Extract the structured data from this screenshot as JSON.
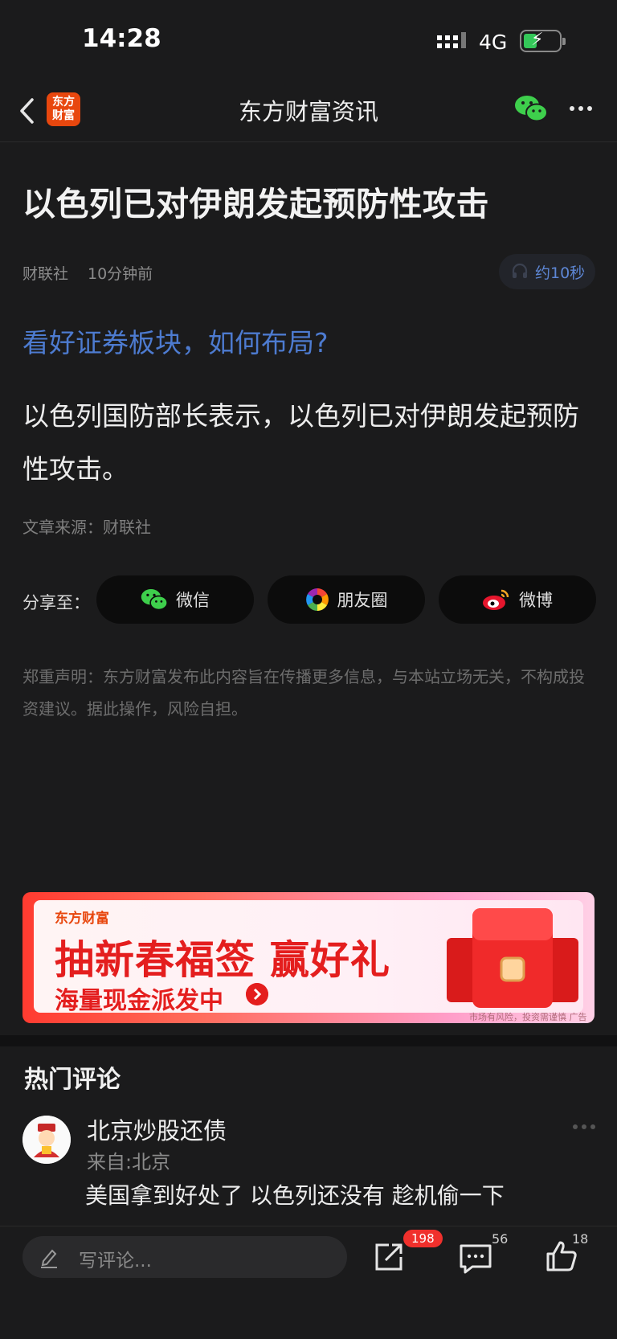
{
  "status_bar": {
    "time": "14:28",
    "network": "4G"
  },
  "nav": {
    "logo_line1": "东方",
    "logo_line2": "财富",
    "title": "东方财富资讯"
  },
  "article": {
    "headline": "以色列已对伊朗发起预防性攻击",
    "source": "财联社",
    "time_ago": "10分钟前",
    "listen_label": "约10秒",
    "promo_link": "看好证券板块，如何布局?",
    "body": "以色列国防部长表示，以色列已对伊朗发起预防性攻击。",
    "source_line": "文章来源：财联社",
    "disclaimer": "郑重声明：东方财富发布此内容旨在传播更多信息，与本站立场无关，不构成投资建议。据此操作，风险自担。"
  },
  "share": {
    "label": "分享至：",
    "buttons": [
      {
        "label": "微信",
        "icon": "wechat-icon"
      },
      {
        "label": "朋友圈",
        "icon": "moments-icon"
      },
      {
        "label": "微博",
        "icon": "weibo-icon"
      }
    ]
  },
  "banner": {
    "brand": "东方财富",
    "title": "抽新春福签 赢好礼",
    "subtitle": "海量现金派发中",
    "risk_note": "市场有风险，投资需谨慎 广告"
  },
  "comments": {
    "section_title": "热门评论",
    "items": [
      {
        "user": "北京炒股还债",
        "location": "来自:北京",
        "text": "美国拿到好处了 以色列还没有 趁机偷一下"
      }
    ]
  },
  "bottom_bar": {
    "input_placeholder": "写评论...",
    "share_count": "198",
    "comment_count": "56",
    "like_count": "18"
  },
  "colors": {
    "accent_blue": "#4d7bd0",
    "badge_red": "#f0302c",
    "brand_orange": "#e8470e",
    "background": "#1b1b1c"
  }
}
